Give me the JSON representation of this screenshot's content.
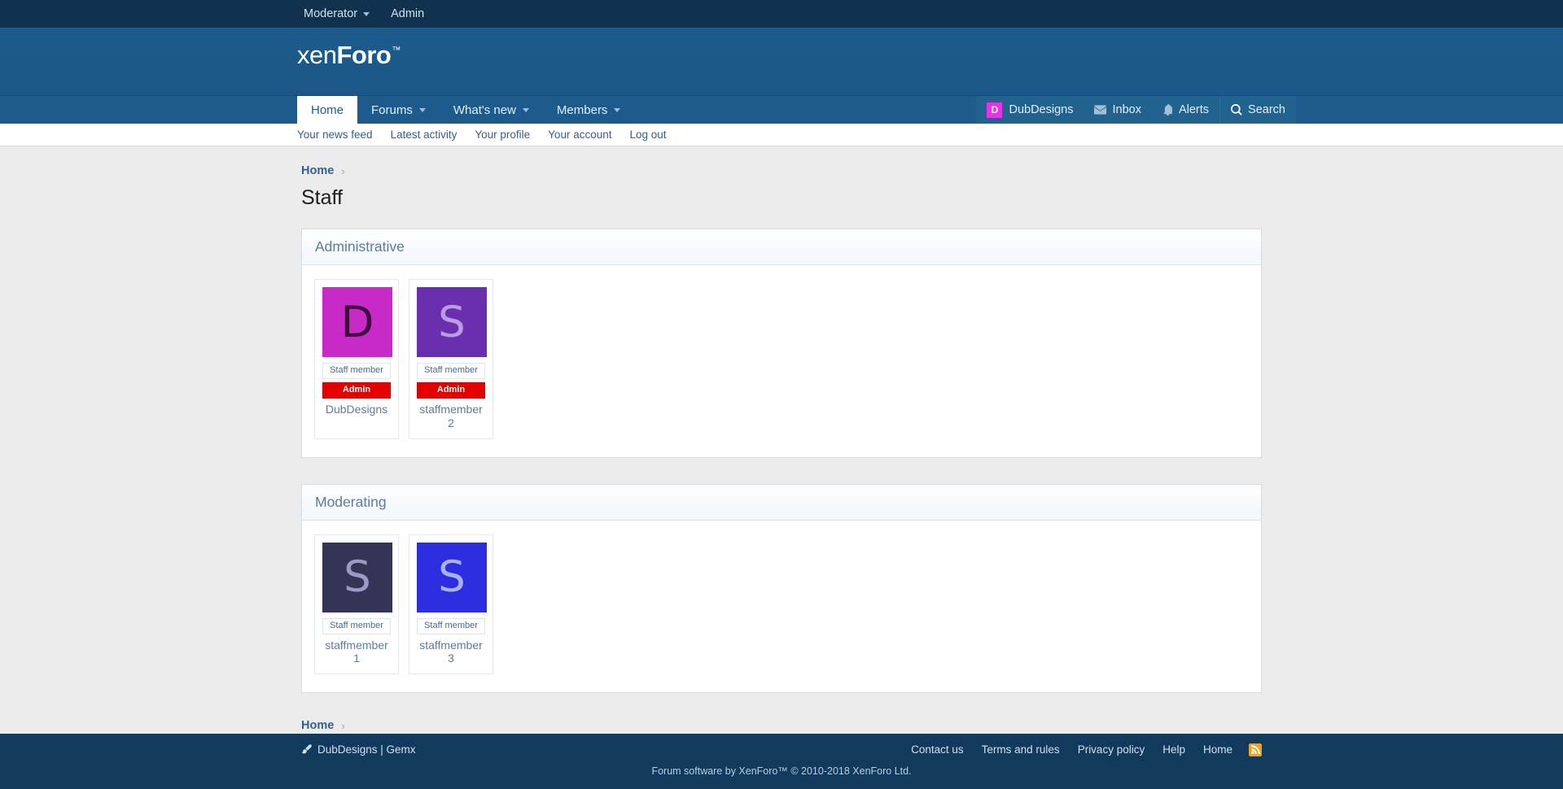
{
  "staff_bar": {
    "items": [
      {
        "label": "Moderator",
        "has_caret": true
      },
      {
        "label": "Admin",
        "has_caret": false
      }
    ]
  },
  "header": {
    "logo_part1": "xen",
    "logo_part2": "Foro",
    "logo_tm": "™"
  },
  "nav": {
    "items": [
      {
        "label": "Home",
        "caret": false,
        "active": true
      },
      {
        "label": "Forums",
        "caret": true,
        "active": false
      },
      {
        "label": "What's new",
        "caret": true,
        "active": false
      },
      {
        "label": "Members",
        "caret": true,
        "active": false
      }
    ]
  },
  "account": {
    "username": "DubDesigns",
    "avatar_letter": "D",
    "avatar_color": "#e831e8",
    "inbox_label": "Inbox",
    "alerts_label": "Alerts",
    "search_label": "Search"
  },
  "subnav": {
    "items": [
      {
        "label": "Your news feed"
      },
      {
        "label": "Latest activity"
      },
      {
        "label": "Your profile"
      },
      {
        "label": "Your account"
      },
      {
        "label": "Log out"
      }
    ]
  },
  "breadcrumb": {
    "home_label": "Home",
    "separator": "›"
  },
  "page": {
    "title": "Staff"
  },
  "sections": [
    {
      "title": "Administrative",
      "members": [
        {
          "username": "DubDesigns",
          "avatar_letter": "D",
          "avatar_bg": "#c82ac8",
          "avatar_fg": "#3d0b3d",
          "badges": [
            {
              "label": "Staff member",
              "type": "staff"
            },
            {
              "label": "Admin",
              "type": "admin"
            }
          ]
        },
        {
          "username": "staffmember2",
          "avatar_letter": "S",
          "avatar_bg": "#6a2fae",
          "avatar_fg": "#b99de0",
          "badges": [
            {
              "label": "Staff member",
              "type": "staff"
            },
            {
              "label": "Admin",
              "type": "admin"
            }
          ]
        }
      ]
    },
    {
      "title": "Moderating",
      "members": [
        {
          "username": "staffmember1",
          "avatar_letter": "S",
          "avatar_bg": "#343455",
          "avatar_fg": "#9a9ac6",
          "badges": [
            {
              "label": "Staff member",
              "type": "staff"
            }
          ]
        },
        {
          "username": "staffmember3",
          "avatar_letter": "S",
          "avatar_bg": "#2d2de0",
          "avatar_fg": "#a8b2ee",
          "badges": [
            {
              "label": "Staff member",
              "type": "staff"
            }
          ]
        }
      ]
    }
  ],
  "footer": {
    "brand": "DubDesigns | Gemx",
    "links": [
      {
        "label": "Contact us"
      },
      {
        "label": "Terms and rules"
      },
      {
        "label": "Privacy policy"
      },
      {
        "label": "Help"
      },
      {
        "label": "Home"
      }
    ],
    "rss_label": "rss-icon",
    "copyright": "Forum software by XenForo™ © 2010-2018 XenForo Ltd."
  },
  "colors": {
    "staffbar_bg": "#10324f",
    "header_bg": "#1d5b8d",
    "body_bg": "#ebebeb",
    "footer_bg": "#123a5c",
    "link": "#33618c",
    "admin_badge": "#e40000"
  }
}
